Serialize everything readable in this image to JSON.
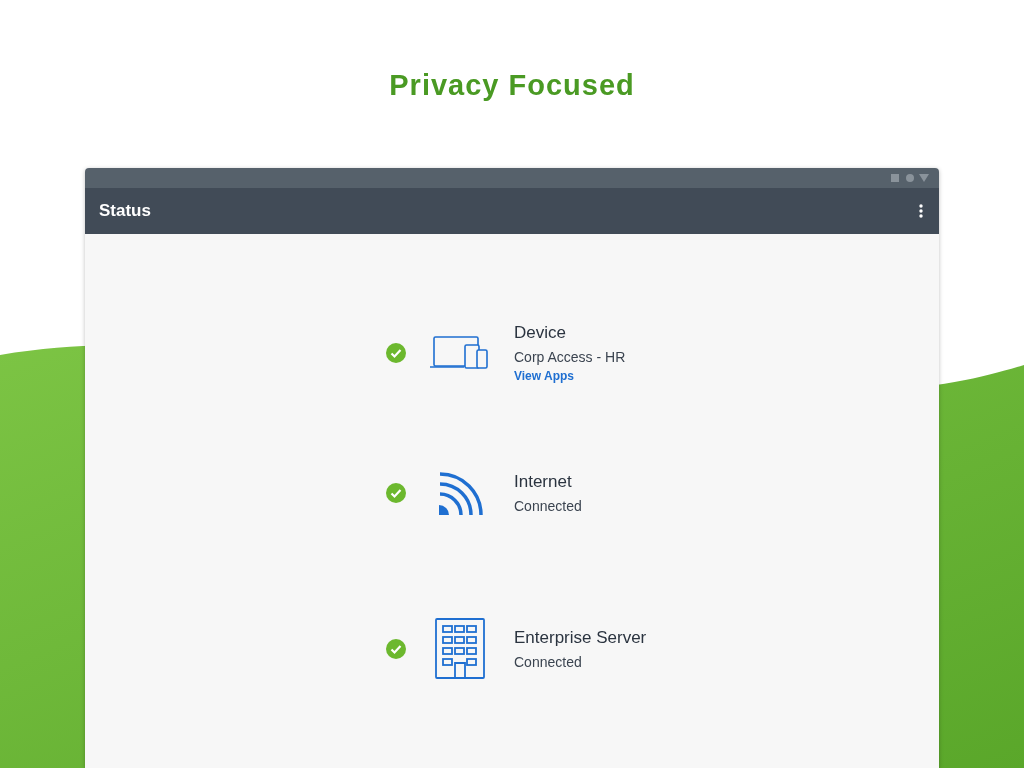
{
  "headline": "Privacy Focused",
  "window": {
    "title": "Status"
  },
  "items": [
    {
      "kind": "device",
      "connected": true,
      "title": "Device",
      "subtitle": "Corp Access - HR",
      "link": "View Apps"
    },
    {
      "kind": "internet",
      "connected": true,
      "title": "Internet",
      "subtitle": "Connected"
    },
    {
      "kind": "server",
      "connected": true,
      "title": "Enterprise Server",
      "subtitle": "Connected"
    }
  ]
}
